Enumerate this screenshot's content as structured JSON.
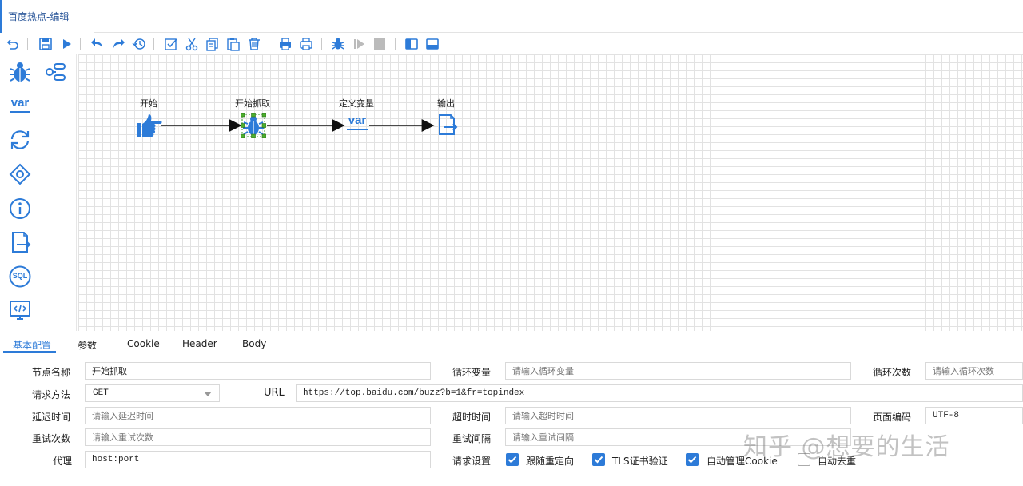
{
  "window": {
    "doc_tab_title": "百度热点-编辑"
  },
  "toolbar": {
    "icons": [
      "undo-icon",
      "save-icon",
      "run-icon",
      "redo-back-icon",
      "redo-icon",
      "history-icon",
      "select-all-icon",
      "cut-icon",
      "copy-icon",
      "paste-icon",
      "delete-icon",
      "export-icon",
      "print-icon",
      "debug-icon",
      "step-icon",
      "stop-icon",
      "left-panel-icon",
      "bottom-panel-icon"
    ]
  },
  "palette": {
    "items": [
      "spider-icon",
      "flow-link-icon",
      "variable-icon",
      "loop-icon",
      "condition-icon",
      "info-icon",
      "output-icon",
      "sql-icon",
      "code-icon"
    ],
    "var_text": "var",
    "sql_text": "SQL"
  },
  "flow": {
    "nodes": [
      {
        "id": "start",
        "label": "开始",
        "icon": "pointing-hand-icon"
      },
      {
        "id": "crawl",
        "label": "开始抓取",
        "icon": "spider-icon"
      },
      {
        "id": "variable",
        "label": "定义变量",
        "icon": "variable-icon",
        "icon_text": "var"
      },
      {
        "id": "output",
        "label": "输出",
        "icon": "output-icon"
      }
    ],
    "accent_color": "#2d7bd8"
  },
  "props": {
    "tabs": [
      "基本配置",
      "参数",
      "Cookie",
      "Header",
      "Body"
    ],
    "active_tab": "基本配置",
    "fields": {
      "node_name": {
        "label": "节点名称",
        "value": "开始抓取"
      },
      "loop_var": {
        "label": "循环变量",
        "placeholder": "请输入循环变量"
      },
      "loop_count": {
        "label": "循环次数",
        "placeholder": "请输入循环次数"
      },
      "method": {
        "label": "请求方法",
        "value": "GET"
      },
      "url": {
        "label": "URL",
        "value": "https://top.baidu.com/buzz?b=1&fr=topindex"
      },
      "delay": {
        "label": "延迟时间",
        "placeholder": "请输入延迟时间"
      },
      "timeout": {
        "label": "超时时间",
        "placeholder": "请输入超时时间"
      },
      "encoding": {
        "label": "页面编码",
        "value": "UTF-8"
      },
      "retries": {
        "label": "重试次数",
        "placeholder": "请输入重试次数"
      },
      "retry_interval": {
        "label": "重试间隔",
        "placeholder": "请输入重试间隔"
      },
      "proxy": {
        "label": "代理",
        "value": "host:port"
      },
      "request_settings": {
        "label": "请求设置",
        "options": [
          {
            "label": "跟随重定向",
            "checked": true
          },
          {
            "label": "TLS证书验证",
            "checked": true
          },
          {
            "label": "自动管理Cookie",
            "checked": true
          },
          {
            "label": "自动去重",
            "checked": false
          }
        ]
      }
    }
  },
  "watermark": "知乎 @想要的生活"
}
